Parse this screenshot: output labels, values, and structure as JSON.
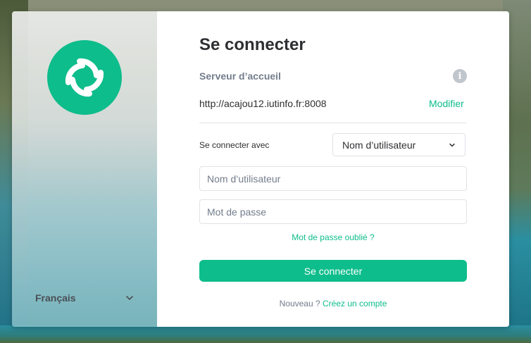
{
  "sidebar": {
    "logo_icon": "element-logo-icon",
    "language": "Français"
  },
  "form": {
    "title": "Se connecter",
    "homeserver_label": "Serveur d’accueil",
    "homeserver_url": "http://acajou12.iutinfo.fr:8008",
    "edit_label": "Modifier",
    "info_icon_glyph": "i",
    "login_with_label": "Se connecter avec",
    "login_with_selected": "Nom d’utilisateur",
    "username_placeholder": "Nom d’utilisateur",
    "password_placeholder": "Mot de passe",
    "forgot_password": "Mot de passe oublié ?",
    "submit_label": "Se connecter",
    "new_prefix": "Nouveau ?",
    "create_account": "Créez un compte"
  },
  "colors": {
    "accent": "#0dbd8b",
    "muted": "#737d8c",
    "text": "#2e2f32"
  }
}
